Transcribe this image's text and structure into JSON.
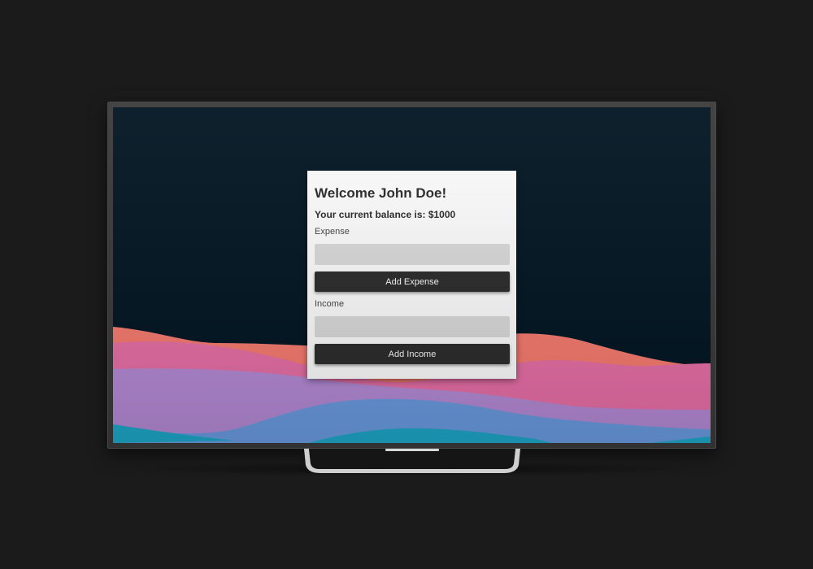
{
  "app": {
    "welcome_heading": "Welcome John Doe!",
    "balance_text": "Your current balance is: $1000"
  },
  "expense": {
    "label": "Expense",
    "value": "",
    "button_label": "Add Expense"
  },
  "income": {
    "label": "Income",
    "value": "",
    "button_label": "Add Income"
  },
  "colors": {
    "page_background": "#1b1b1b",
    "screen_background": "#011522",
    "card_background": "#ffffff",
    "button_background": "#2b2b2b",
    "input_background": "#dcdcdc",
    "wave_coral": "#f97b6f",
    "wave_pink": "#e96fa7",
    "wave_lavender": "#b58ad6",
    "wave_blue": "#6a9be0",
    "wave_teal": "#1ea7c8"
  }
}
